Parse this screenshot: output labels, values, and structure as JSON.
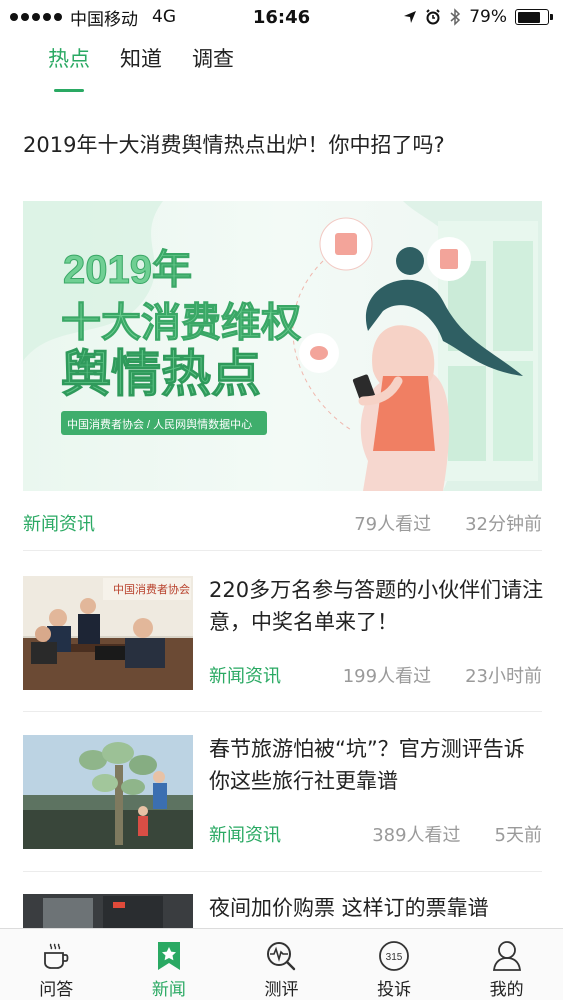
{
  "status_bar": {
    "carrier": "中国移动",
    "network": "4G",
    "time": "16:46",
    "battery": "79%",
    "battery_level": 0.79
  },
  "tabs": [
    {
      "label": "热点",
      "active": true
    },
    {
      "label": "知道",
      "active": false
    },
    {
      "label": "调查",
      "active": false
    }
  ],
  "featured": {
    "title": "2019年十大消费舆情热点出炉！你中招了吗?",
    "banner": {
      "line1": "2019年",
      "line2": "十大消费维权",
      "line3": "舆情热点",
      "org": "中国消费者协会 / 人民网舆情数据中心"
    },
    "category": "新闻资讯",
    "views": "79人看过",
    "time": "32分钟前"
  },
  "news": [
    {
      "title": "220多万名参与答题的小伙伴们请注意，中奖名单来了！",
      "category": "新闻资讯",
      "views": "199人看过",
      "time": "23小时前"
    },
    {
      "title": "春节旅游怕被“坑”？官方测评告诉你这些旅行社更靠谱",
      "category": "新闻资讯",
      "views": "389人看过",
      "time": "5天前"
    },
    {
      "title": "夜间加价购票 这样订的票靠谱",
      "category": "",
      "views": "",
      "time": ""
    }
  ],
  "bottom_nav": [
    {
      "label": "问答",
      "icon": "cup-icon",
      "active": false
    },
    {
      "label": "新闻",
      "icon": "star-bookmark-icon",
      "active": true
    },
    {
      "label": "测评",
      "icon": "pulse-search-icon",
      "active": false
    },
    {
      "label": "投诉",
      "icon": "315-icon",
      "active": false
    },
    {
      "label": "我的",
      "icon": "person-icon",
      "active": false
    }
  ],
  "icons": {
    "thumb1_sign": "中国消费者协会",
    "badge_315": "315"
  },
  "colors": {
    "accent": "#2aa963",
    "muted": "#9a9a9a"
  }
}
